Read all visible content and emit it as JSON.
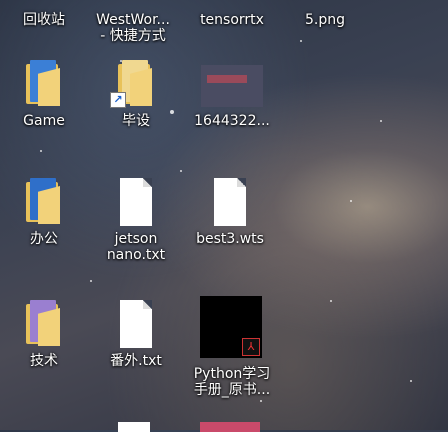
{
  "top_row": [
    {
      "id": "recycle",
      "label": "回收站"
    },
    {
      "id": "westworld",
      "label": "WestWor...\n- 快捷方式"
    },
    {
      "id": "tensorrt",
      "label": "tensorrtx"
    },
    {
      "id": "png",
      "label": "5.png"
    }
  ],
  "icons": [
    {
      "id": "game",
      "label": "Game",
      "icon": "folder-icon",
      "type": "folder",
      "doc_color": "#3b7fd6"
    },
    {
      "id": "bishe",
      "label": "毕设",
      "icon": "folder-shortcut-icon",
      "type": "folder-shortcut",
      "doc_color": "#f0d890"
    },
    {
      "id": "img1644",
      "label": "1644322...",
      "icon": "image-thumbnail-icon",
      "type": "thumb"
    },
    {
      "id": "bangong",
      "label": "办公",
      "icon": "folder-icon",
      "type": "folder",
      "doc_color": "#2f6fc9"
    },
    {
      "id": "jetson",
      "label": "jetson\nnano.txt",
      "icon": "text-file-icon",
      "type": "doc"
    },
    {
      "id": "best3",
      "label": "best3.wts",
      "icon": "file-icon",
      "type": "doc"
    },
    {
      "id": "jishu",
      "label": "技术",
      "icon": "folder-icon",
      "type": "folder",
      "doc_color": "#9a7fd0"
    },
    {
      "id": "fanwai",
      "label": "番外.txt",
      "icon": "text-file-icon",
      "type": "doc"
    },
    {
      "id": "python",
      "label": "Python学习\n手册_原书...",
      "icon": "pdf-file-icon",
      "type": "pdf"
    }
  ],
  "shortcut_arrow": "↗",
  "pdf_symbol": "⅄"
}
